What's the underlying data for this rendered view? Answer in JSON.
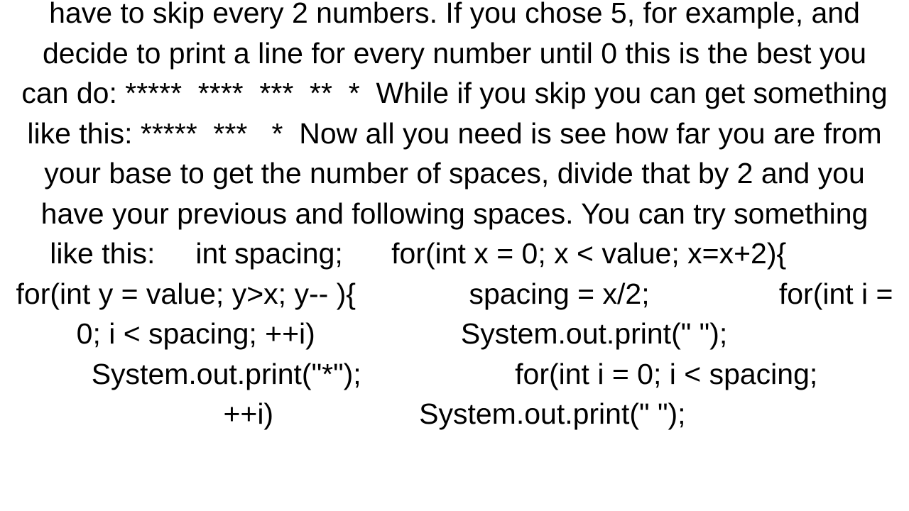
{
  "text": "have to skip every 2 numbers. If you chose 5, for example, and decide to print a line for every number until 0 this is the best you can do: *****  ****  ***  **  *  While if you skip you can get something like this: *****  ***   *  Now all you need is see how far you are from your base to get the number of spaces, divide that by 2 and you have your previous and following spaces. You can try something like this:     int spacing;      for(int x = 0; x < value; x=x+2){          for(int y = value; y>x; y-- ){              spacing = x/2;                for(int i = 0; i < spacing; ++i)                  System.out.print(\" \");              System.out.print(\"*\");                   for(int i = 0; i < spacing; ++i)                  System.out.print(\" \");"
}
